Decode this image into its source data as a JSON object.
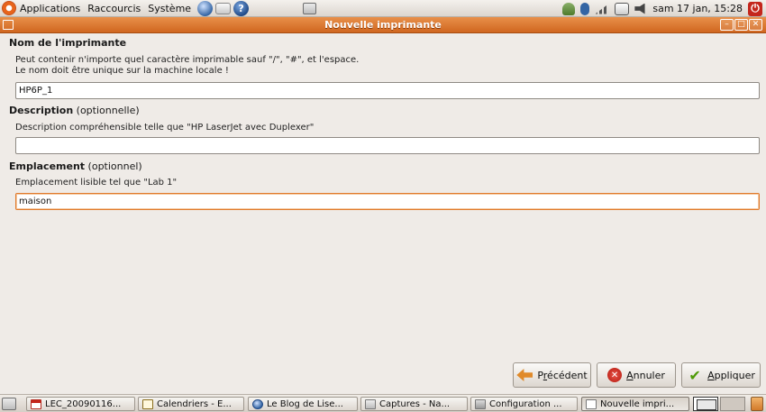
{
  "top_panel": {
    "menus": [
      "Applications",
      "Raccourcis",
      "Système"
    ],
    "clock": "sam 17 jan, 15:28"
  },
  "window": {
    "title": "Nouvelle imprimante",
    "controls": [
      "minimize-icon",
      "maximize-icon",
      "close-icon"
    ]
  },
  "form": {
    "name_section": {
      "heading": "Nom de l'imprimante",
      "hint_line1": "Peut contenir n'importe quel caractère imprimable sauf \"/\", \"#\", et l'espace.",
      "hint_line2": "Le nom doit être unique sur la machine locale !",
      "value": "HP6P_1"
    },
    "description_section": {
      "heading": "Description",
      "qualifier": "(optionnelle)",
      "hint": "Description compréhensible telle que \"HP LaserJet avec Duplexer\"",
      "value": ""
    },
    "location_section": {
      "heading": "Emplacement",
      "qualifier": "(optionnel)",
      "hint": "Emplacement lisible tel que \"Lab 1\"",
      "value": "maison"
    }
  },
  "buttons": {
    "previous": {
      "prefix": "P",
      "mnemonic": "r",
      "rest": "écédent"
    },
    "cancel": {
      "mnemonic": "A",
      "rest": "nnuler"
    },
    "apply": {
      "mnemonic": "A",
      "rest": "ppliquer"
    }
  },
  "taskbar": {
    "items": [
      "LEC_20090116...",
      "Calendriers - E...",
      "Le Blog de Lise...",
      "Captures - Na...",
      "Configuration ...",
      "Nouvelle impri..."
    ]
  },
  "colors": {
    "titlebar": "#d0661f",
    "focus_border": "#e07a2c",
    "window_bg": "#efebe7"
  }
}
